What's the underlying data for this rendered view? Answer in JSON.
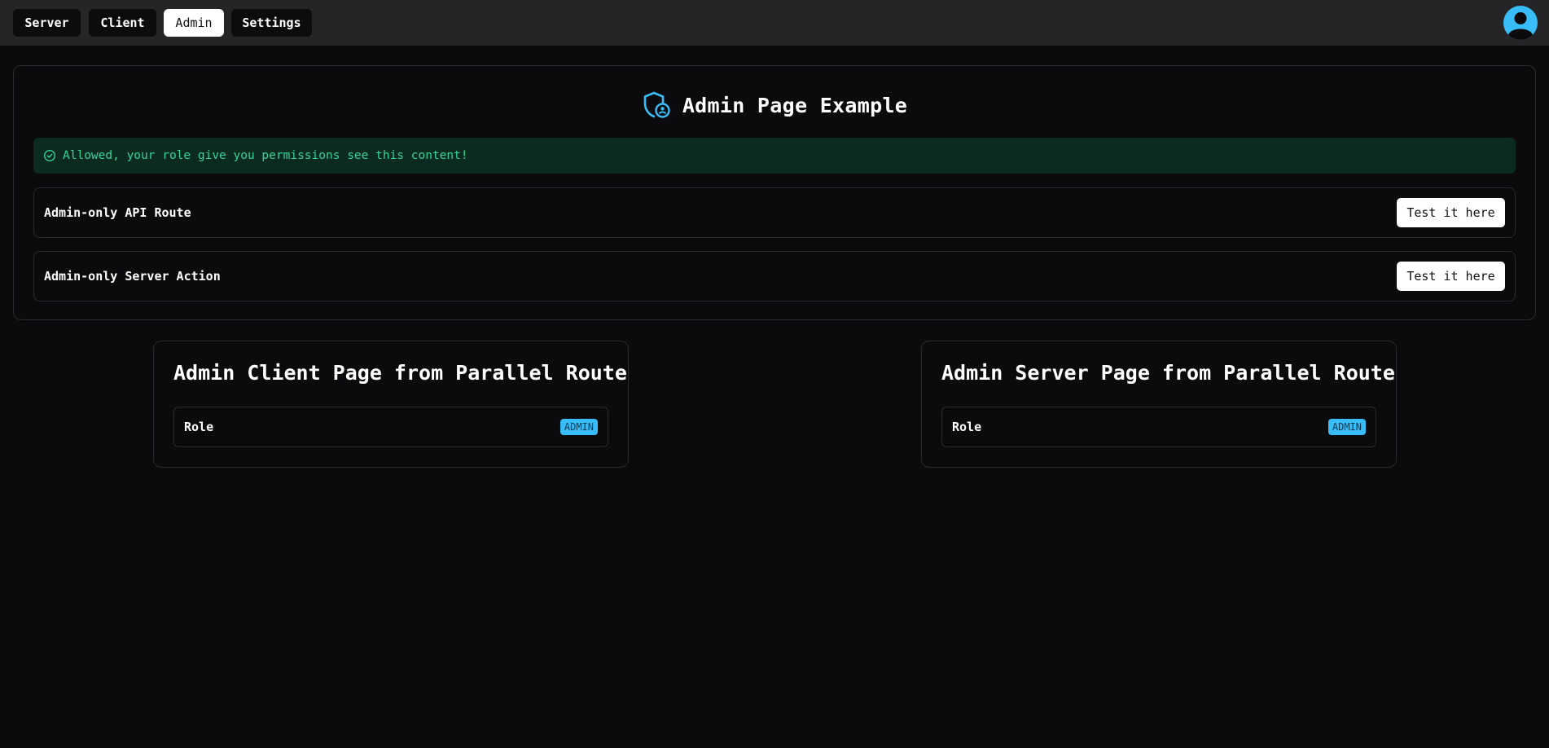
{
  "nav": {
    "items": [
      {
        "label": "Server"
      },
      {
        "label": "Client"
      },
      {
        "label": "Admin"
      },
      {
        "label": "Settings"
      }
    ],
    "active": "Admin",
    "avatar_icon": "user-avatar-icon"
  },
  "main": {
    "title": "Admin Page Example",
    "title_icon": "shield-user-icon",
    "alert": {
      "icon": "check-circle-icon",
      "text": "Allowed, your role give you permissions see this content!"
    },
    "rows": [
      {
        "label": "Admin-only API Route",
        "button": "Test it here"
      },
      {
        "label": "Admin-only Server Action",
        "button": "Test it here"
      }
    ]
  },
  "panels": [
    {
      "title": "Admin Client Page from Parallel Route",
      "role_label": "Role",
      "role_value": "ADMIN"
    },
    {
      "title": "Admin Server Page from Parallel Route",
      "role_label": "Role",
      "role_value": "ADMIN"
    }
  ],
  "colors": {
    "accent": "#38bdf8",
    "success": "#34d399",
    "success_bg": "#0b2b21",
    "background": "#0b0b0d",
    "topbar": "#252527"
  }
}
